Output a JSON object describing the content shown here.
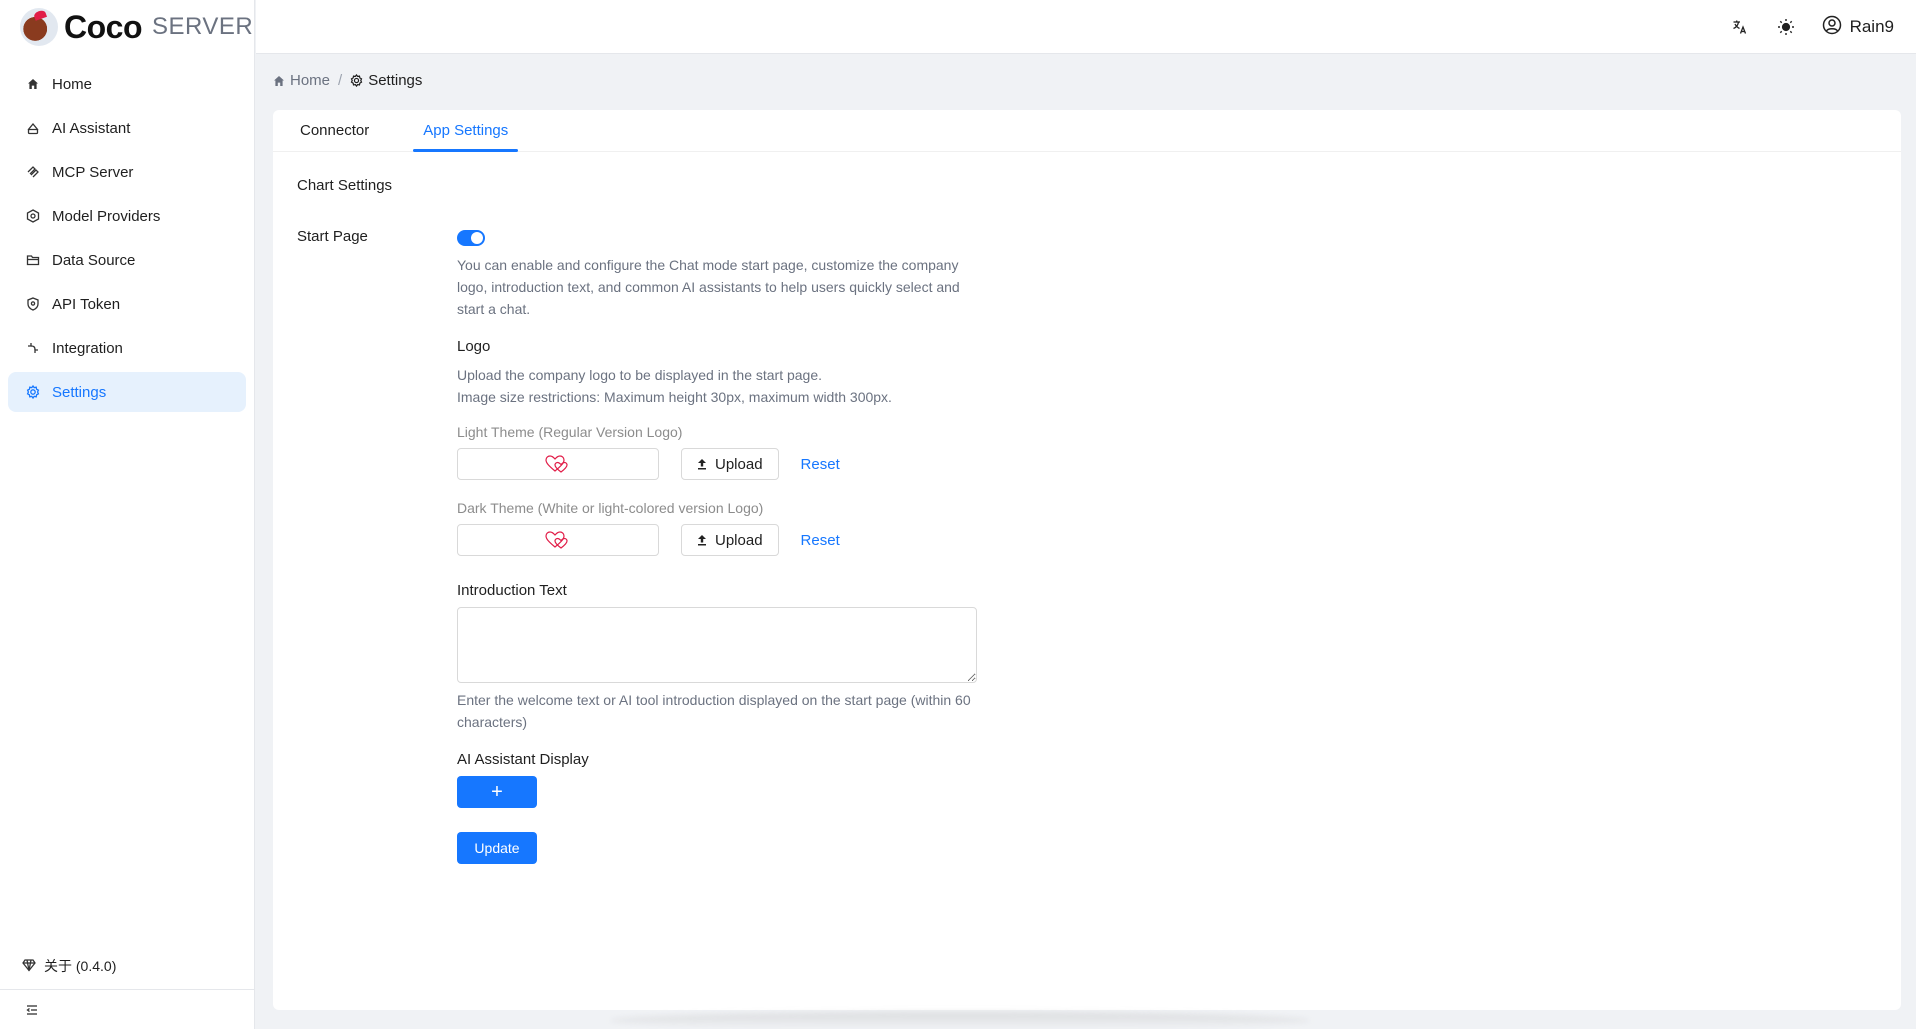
{
  "brand": {
    "name": "Coco",
    "suffix": "SERVER"
  },
  "sidebar": {
    "items": [
      {
        "label": "Home",
        "icon": "home-icon"
      },
      {
        "label": "AI Assistant",
        "icon": "robot-icon"
      },
      {
        "label": "MCP Server",
        "icon": "mcp-icon"
      },
      {
        "label": "Model Providers",
        "icon": "model-icon"
      },
      {
        "label": "Data Source",
        "icon": "folder-icon"
      },
      {
        "label": "API Token",
        "icon": "shield-icon"
      },
      {
        "label": "Integration",
        "icon": "integration-icon"
      },
      {
        "label": "Settings",
        "icon": "gear-icon",
        "active": true
      }
    ],
    "about": "关于 (0.4.0)"
  },
  "header": {
    "user": "Rain9"
  },
  "breadcrumb": {
    "home": "Home",
    "current": "Settings"
  },
  "tabs": [
    {
      "label": "Connector"
    },
    {
      "label": "App Settings",
      "active": true
    }
  ],
  "form": {
    "section_title": "Chart Settings",
    "start_page": {
      "label": "Start Page",
      "enabled": true,
      "description": "You can enable and configure the Chat mode start page, customize the company logo, introduction text, and common AI assistants to help users quickly select and start a chat."
    },
    "logo": {
      "label": "Logo",
      "desc1": "Upload the company logo to be displayed in the start page.",
      "desc2": "Image size restrictions: Maximum height 30px, maximum width 300px.",
      "light_label": "Light Theme (Regular Version Logo)",
      "dark_label": "Dark Theme (White or light-colored version Logo)",
      "upload_label": "Upload",
      "reset_label": "Reset"
    },
    "intro": {
      "label": "Introduction Text",
      "value": "",
      "help": "Enter the welcome text or AI tool introduction displayed on the start page (within 60 characters)"
    },
    "assistant_display": {
      "label": "AI Assistant Display",
      "add_label": "+"
    },
    "update_label": "Update"
  },
  "colors": {
    "accent": "#1677ff",
    "active_bg": "#e6f1fd"
  }
}
